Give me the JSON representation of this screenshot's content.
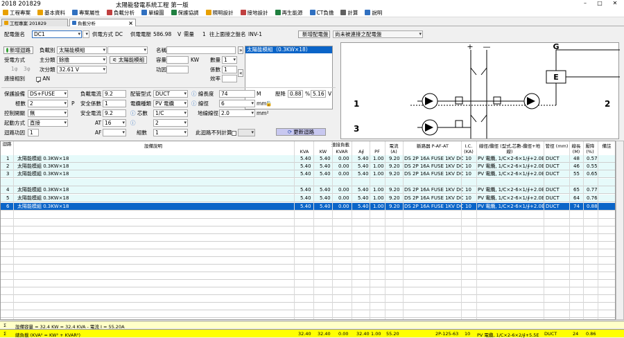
{
  "titlebar": {
    "app_prefix": "2018 201829",
    "doc_title": "太陽能發電系統工程 第一版",
    "min": "–",
    "max": "□",
    "close": "✕"
  },
  "menu": [
    {
      "label": "工程專案",
      "color": "#e8a000"
    },
    {
      "label": "基本資料",
      "color": "#e8a000"
    },
    {
      "label": "專案屬性",
      "color": "#3070c0"
    },
    {
      "label": "負載分析",
      "color": "#c04040"
    },
    {
      "label": "單線圖",
      "color": "#3070c0"
    },
    {
      "label": "保護協調",
      "color": "#208040"
    },
    {
      "label": "照明設計",
      "color": "#e8a000"
    },
    {
      "label": "接地設計",
      "color": "#c04040"
    },
    {
      "label": "再生能源",
      "color": "#208040"
    },
    {
      "label": "CT負擔",
      "color": "#3070c0"
    },
    {
      "label": "計算",
      "color": "#606060"
    },
    {
      "label": "說明",
      "color": "#3070c0"
    }
  ],
  "tabs": {
    "project": "工程專案 201829",
    "analysis": "負載分析",
    "close": "×"
  },
  "panel": {
    "board_label": "配電盤名",
    "board_value": "DC1",
    "supply_label": "供電方式",
    "supply_value": "DC",
    "voltage_label": "供電電壓",
    "voltage_value": "586.98",
    "voltage_unit": "V",
    "demand_label": "需量",
    "demand_value": "1",
    "upstream_label": "往上面接之盤名",
    "upstream_value": "INV-1",
    "add_board": "新增配電盤",
    "unconnected": "尚未被連接之配電盤"
  },
  "form": {
    "add_circuit": "新增迴路",
    "load_cat_label": "負載別",
    "load_cat_value": "太陽能模組",
    "name_label": "名稱",
    "recv_label": "受電方式",
    "main_cat_label": "主分類",
    "main_cat_value": "餘擔",
    "solar_btn": "太陽能模組",
    "capacity_label": "容量",
    "kw_unit": "KW",
    "qty_label": "數量",
    "qty_value": "1",
    "phase1": "1φ",
    "phase3": "3φ",
    "sub_cat_label": "次分類",
    "sub_cat_value": "32.61 V",
    "pf_label": "功因",
    "coef_label": "係數",
    "coef_value": "1",
    "conn_label": "連接相別",
    "an_label": "AN",
    "eff_label": "效率",
    "list_item": "太陽能模組（0.3KW×18）",
    "prot_label": "保護設備",
    "prot_value": "DS+FUSE",
    "load_current_label": "負載電流",
    "load_current_value": "9.2",
    "pipe_type_label": "配管型式",
    "pipe_type_value": "DUCT",
    "length_label": "線長度",
    "length_value": "74",
    "length_unit": "M",
    "vdrop_label": "壓降",
    "vdrop1": "0.88",
    "vdrop_pct": "%",
    "vdrop2": "5.16",
    "vdrop_v": "V",
    "poles_label": "極數",
    "poles_value": "2",
    "p_unit": "P",
    "safety_label": "安全係數",
    "safety_value": "1",
    "cable_type_label": "電纜種類",
    "cable_type_value": "PV 電纜",
    "size_label": "線徑",
    "size_value": "6",
    "mm2": "mm²",
    "ctrl_label": "控制開關",
    "ctrl_value": "無",
    "safe_current_label": "安全電流",
    "safe_current_value": "9.2",
    "core_label": "芯數",
    "core_value": "1/C",
    "ground_label": "地線線徑",
    "ground_value": "2.0",
    "start_label": "起動方式",
    "start_value": "直接",
    "at_label": "AT",
    "at_value": "16",
    "parallel_label": "",
    "parallel_value": "2",
    "loop_label": "迴路功因",
    "loop_value": "1",
    "af_label": "AF",
    "af_value": "",
    "group_label": "組數",
    "group_value": "1",
    "exclude_label": "此迴路不列計算",
    "update_btn": "更新迴路"
  },
  "diagram": {
    "plus": "+",
    "minus": "—",
    "g": "G",
    "e": "E",
    "n1": "1",
    "n2": "2",
    "n3": "3"
  },
  "table": {
    "headers": [
      "迴路",
      "設備說明",
      "KVA",
      "KW",
      "KVAR",
      "A∮",
      "PF",
      "電流 (A)",
      "斷路器 P-AF-AT",
      "I.C. (KA)",
      "線徑/纜徑 (型式,芯數-纜徑+地線)",
      "管徑 (mm)",
      "線長 (M)",
      "壓降 (%)",
      "備註"
    ],
    "header_top": {
      "load": "連接負載"
    },
    "rows": [
      {
        "no": "1",
        "desc": "太陽能模組 0.3KW×18",
        "kva": "5.40",
        "kw": "5.40",
        "kvar": "0.00",
        "a": "5.40",
        "pf": "1.00",
        "amp": "9.20",
        "brk": "DS 2P 16A FUSE 1KV DC",
        "ic": "10",
        "wire": "PV 電纜, 1/C×2-6×1/∮+2.0E",
        "pipe": "DUCT",
        "len": "48",
        "vd": "0.57",
        "style": "cyan"
      },
      {
        "no": "2",
        "desc": "太陽能模組 0.3KW×18",
        "kva": "5.40",
        "kw": "5.40",
        "kvar": "0.00",
        "a": "5.40",
        "pf": "1.00",
        "amp": "9.20",
        "brk": "DS 2P 16A FUSE 1KV DC",
        "ic": "10",
        "wire": "PV 電纜, 1/C×2-6×1/∮+2.0E",
        "pipe": "DUCT",
        "len": "46",
        "vd": "0.55",
        "style": "cyan"
      },
      {
        "no": "3",
        "desc": "太陽能模組 0.3KW×18",
        "kva": "5.40",
        "kw": "5.40",
        "kvar": "0.00",
        "a": "5.40",
        "pf": "1.00",
        "amp": "9.20",
        "brk": "DS 2P 16A FUSE 1KV DC",
        "ic": "10",
        "wire": "PV 電纜, 1/C×2-6×1/∮+2.0E",
        "pipe": "DUCT",
        "len": "55",
        "vd": "0.65",
        "style": "cyan"
      },
      {
        "no": "4",
        "desc": "太陽能模組 0.3KW×18",
        "kva": "5.40",
        "kw": "5.40",
        "kvar": "0.00",
        "a": "5.40",
        "pf": "1.00",
        "amp": "9.20",
        "brk": "DS 2P 16A FUSE 1KV DC",
        "ic": "10",
        "wire": "PV 電纜, 1/C×2-6×1/∮+2.0E",
        "pipe": "DUCT",
        "len": "65",
        "vd": "0.77",
        "style": "cyan"
      },
      {
        "no": "5",
        "desc": "太陽能模組 0.3KW×18",
        "kva": "5.40",
        "kw": "5.40",
        "kvar": "0.00",
        "a": "5.40",
        "pf": "1.00",
        "amp": "9.20",
        "brk": "DS 2P 16A FUSE 1KV DC",
        "ic": "10",
        "wire": "PV 電纜, 1/C×2-6×1/∮+2.0E",
        "pipe": "DUCT",
        "len": "64",
        "vd": "0.76",
        "style": "cyan"
      },
      {
        "no": "6",
        "desc": "太陽能模組 0.3KW×18",
        "kva": "5.40",
        "kw": "5.40",
        "kvar": "0.00",
        "a": "5.40",
        "pf": "1.00",
        "amp": "9.20",
        "brk": "DS 2P 16A FUSE 1KV DC",
        "ic": "10",
        "wire": "PV 電纜, 1/C×2-6×1/∮+2.0E",
        "pipe": "DUCT",
        "len": "74",
        "vd": "0.88",
        "style": "hl"
      }
    ]
  },
  "footer": {
    "sigma": "Σ",
    "sum_text": "設備容量 = 32.4 KW = 32.4 KVA - 電流 I = 55.20A",
    "total_label": "總負載 (KVA² = KW² + KVAR²)",
    "kva": "32.40",
    "kw": "32.40",
    "kvar": "0.00",
    "a": "32.40",
    "pf": "1.00",
    "amp": "55.20",
    "brk": "2P-125-63",
    "ic": "10",
    "wire": "PV 電纜, 1/C×2-6×2/∮+5.5E",
    "pipe": "DUCT",
    "len": "24",
    "vd": "0.86"
  }
}
